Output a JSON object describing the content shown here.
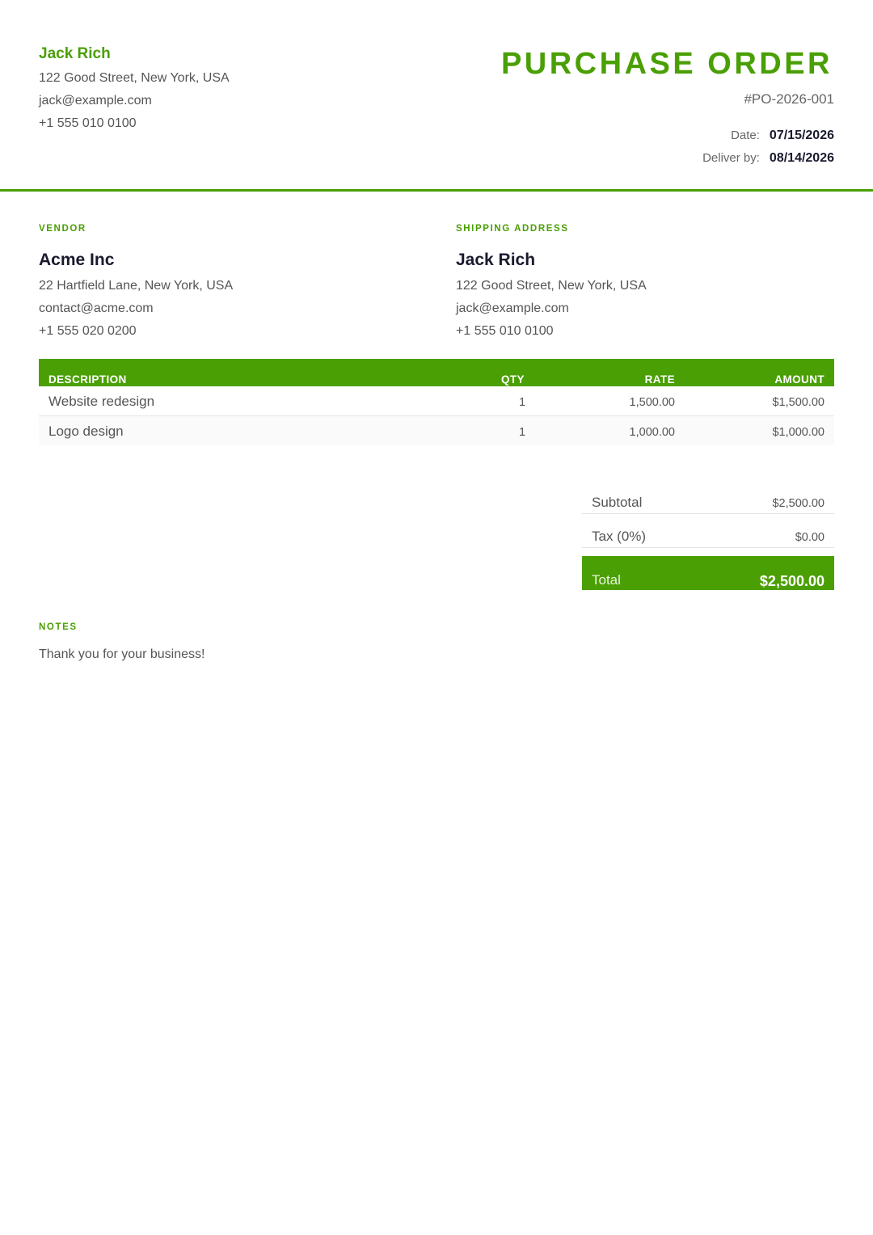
{
  "sender": {
    "name": "Jack Rich",
    "address": "122 Good Street, New York, USA",
    "email": "jack@example.com",
    "phone": "+1 555 010 0100"
  },
  "document": {
    "title": "PURCHASE ORDER",
    "number": "#PO-2026-001",
    "date_label": "Date:",
    "date_value": "07/15/2026",
    "deliver_label": "Deliver by:",
    "deliver_value": "08/14/2026"
  },
  "vendor": {
    "label": "VENDOR",
    "name": "Acme Inc",
    "address": "22 Hartfield Lane, New York, USA",
    "email": "contact@acme.com",
    "phone": "+1 555 020 0200"
  },
  "shipping": {
    "label": "SHIPPING ADDRESS",
    "name": "Jack Rich",
    "address": "122 Good Street, New York, USA",
    "email": "jack@example.com",
    "phone": "+1 555 010 0100"
  },
  "items": {
    "headers": {
      "description": "DESCRIPTION",
      "qty": "QTY",
      "rate": "RATE",
      "amount": "AMOUNT"
    },
    "rows": [
      {
        "description": "Website redesign",
        "qty": "1",
        "rate": "1,500.00",
        "amount": "$1,500.00"
      },
      {
        "description": "Logo design",
        "qty": "1",
        "rate": "1,000.00",
        "amount": "$1,000.00"
      }
    ]
  },
  "totals": {
    "subtotal_label": "Subtotal",
    "subtotal_value": "$2,500.00",
    "tax_label": "Tax (0%)",
    "tax_value": "$0.00",
    "total_label": "Total",
    "total_value": "$2,500.00"
  },
  "notes": {
    "label": "NOTES",
    "text": "Thank you for your business!"
  },
  "colors": {
    "accent": "#4a9f04",
    "heading": "#1a1a2e",
    "text": "#555555"
  }
}
